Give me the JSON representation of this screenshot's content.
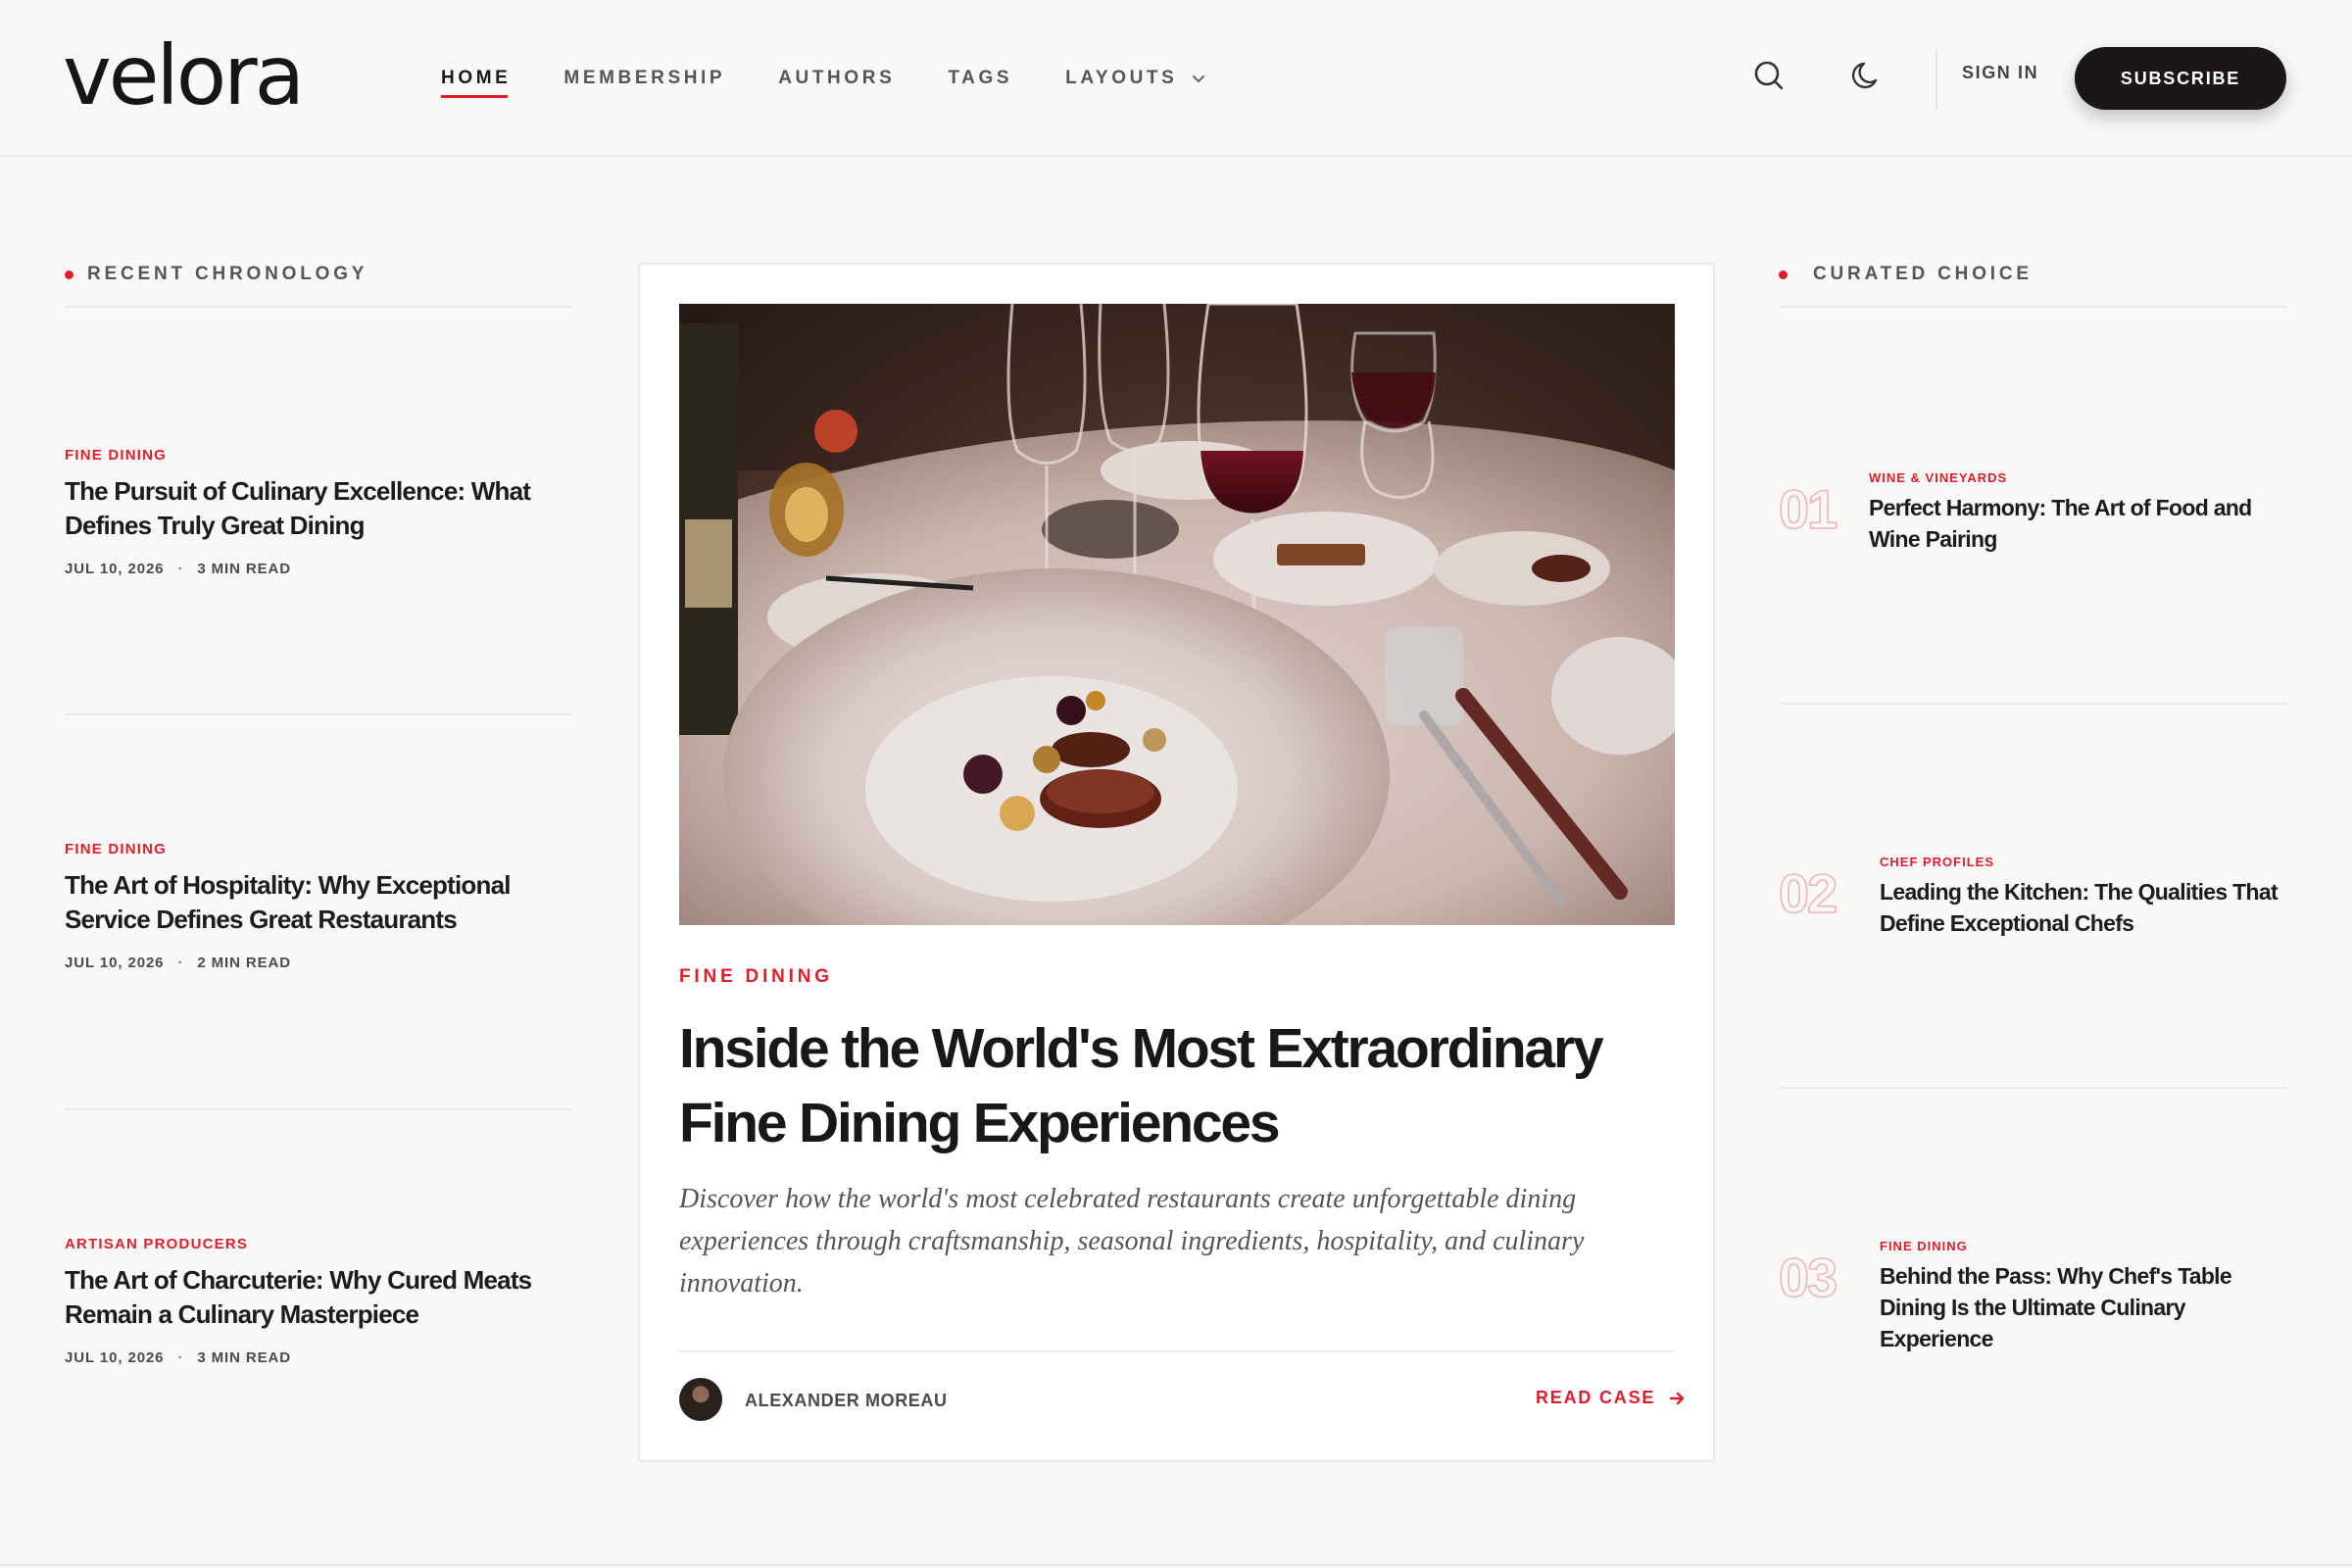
{
  "brand": {
    "logo_text": "velora"
  },
  "nav": {
    "items": [
      {
        "label": "HOME",
        "active": true
      },
      {
        "label": "MEMBERSHIP",
        "active": false
      },
      {
        "label": "AUTHORS",
        "active": false
      },
      {
        "label": "TAGS",
        "active": false
      },
      {
        "label": "LAYOUTS",
        "active": false,
        "has_dropdown": true
      }
    ]
  },
  "header": {
    "icons": [
      "search-icon",
      "moon-icon"
    ],
    "sign_in": "SIGN IN",
    "subscribe": "SUBSCRIBE"
  },
  "recent": {
    "heading": "RECENT CHRONOLOGY",
    "items": [
      {
        "category": "FINE DINING",
        "title": "The Pursuit of Culinary Excellence: What Defines Truly Great Dining",
        "date": "JUL 10, 2026",
        "read_time": "3 MIN READ"
      },
      {
        "category": "FINE DINING",
        "title": "The Art of Hospitality: Why Exceptional Service Defines Great Restaurants",
        "date": "JUL 10, 2026",
        "read_time": "2 MIN READ"
      },
      {
        "category": "ARTISAN PRODUCERS",
        "title": "The Art of Charcuterie: Why Cured Meats Remain a Culinary Masterpiece",
        "date": "JUL 10, 2026",
        "read_time": "3 MIN READ"
      }
    ]
  },
  "featured": {
    "category": "FINE DINING",
    "title": "Inside the World's Most Extraordinary Fine Dining Experiences",
    "excerpt": "Discover how the world's most celebrated restaurants create unforgettable dining experiences through craftsmanship, seasonal ingredients, hospitality, and culinary innovation.",
    "author": "ALEXANDER MOREAU",
    "cta": "READ CASE"
  },
  "curated": {
    "heading": "CURATED CHOICE",
    "items": [
      {
        "number": "01",
        "category": "WINE & VINEYARDS",
        "title": "Perfect Harmony: The Art of Food and Wine Pairing"
      },
      {
        "number": "02",
        "category": "CHEF PROFILES",
        "title": "Leading the Kitchen: The Qualities That Define Exceptional Chefs"
      },
      {
        "number": "03",
        "category": "FINE DINING",
        "title": "Behind the Pass: Why Chef's Table Dining Is the Ultimate Culinary Experience"
      }
    ]
  },
  "colors": {
    "accent": "#e11d2a",
    "dark": "#1b1718",
    "background": "#f8f8f6"
  }
}
